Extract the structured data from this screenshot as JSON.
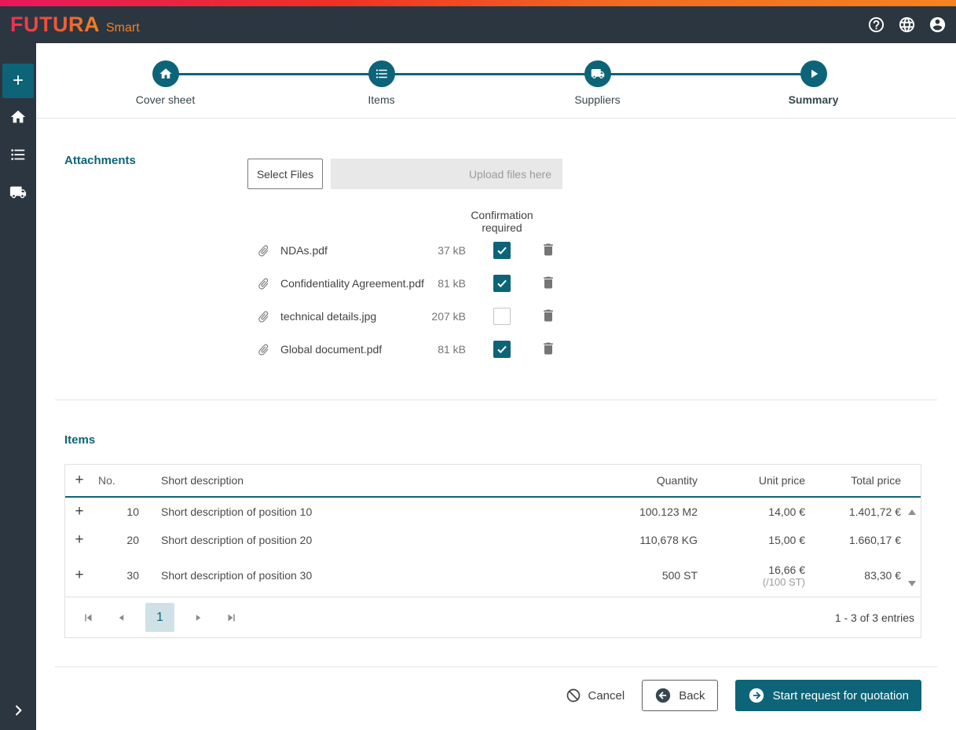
{
  "colors": {
    "accent_teal": "#0d6478",
    "header_bg": "#2b3640",
    "brand_gradient_start": "#e8175d",
    "brand_gradient_end": "#f58220",
    "brand_text_orange": "#f58220",
    "current_page_bg": "#cfe1e7",
    "upload_zone_bg": "#e8e8e8"
  },
  "header": {
    "brand": "FUTURA",
    "brand_suffix": "Smart",
    "icons": [
      "help-icon",
      "language-globe-icon",
      "account-icon"
    ]
  },
  "sidebar": {
    "add_label": "+",
    "icons": [
      "add-icon",
      "home-icon",
      "list-icon",
      "shipping-truck-icon",
      "chevron-right-icon"
    ]
  },
  "stepper": {
    "steps": [
      {
        "label": "Cover sheet",
        "icon": "home-icon",
        "active": false
      },
      {
        "label": "Items",
        "icon": "list-icon",
        "active": false
      },
      {
        "label": "Suppliers",
        "icon": "truck-icon",
        "active": false
      },
      {
        "label": "Summary",
        "icon": "play-icon",
        "active": true
      }
    ]
  },
  "attachments": {
    "title": "Attachments",
    "select_files_label": "Select Files",
    "upload_hint": "Upload files here",
    "confirmation_header": "Confirmation required",
    "files": [
      {
        "name": "NDAs.pdf",
        "size": "37 kB",
        "confirmed": true
      },
      {
        "name": "Confidentiality Agreement.pdf",
        "size": "81 kB",
        "confirmed": true
      },
      {
        "name": "technical details.jpg",
        "size": "207 kB",
        "confirmed": false
      },
      {
        "name": "Global document.pdf",
        "size": "81 kB",
        "confirmed": true
      }
    ]
  },
  "items": {
    "title": "Items",
    "expand_symbol": "+",
    "columns": {
      "no": "No.",
      "description": "Short description",
      "quantity": "Quantity",
      "unit_price": "Unit price",
      "total_price": "Total price"
    },
    "rows": [
      {
        "no": "10",
        "description": "Short description of position 10",
        "quantity": "100.123 M2",
        "unit_price": "14,00 €",
        "unit_price_note": "",
        "total_price": "1.401,72 €"
      },
      {
        "no": "20",
        "description": "Short description of position 20",
        "quantity": "110,678 KG",
        "unit_price": "15,00 €",
        "unit_price_note": "",
        "total_price": "1.660,17 €"
      },
      {
        "no": "30",
        "description": "Short description of position 30",
        "quantity": "500 ST",
        "unit_price": "16,66 €",
        "unit_price_note": "(/100 ST)",
        "total_price": "83,30 €"
      }
    ],
    "pagination": {
      "current_page": "1",
      "summary": "1 - 3 of 3 entries"
    }
  },
  "footer": {
    "cancel_label": "Cancel",
    "back_label": "Back",
    "submit_label": "Start request for quotation"
  }
}
